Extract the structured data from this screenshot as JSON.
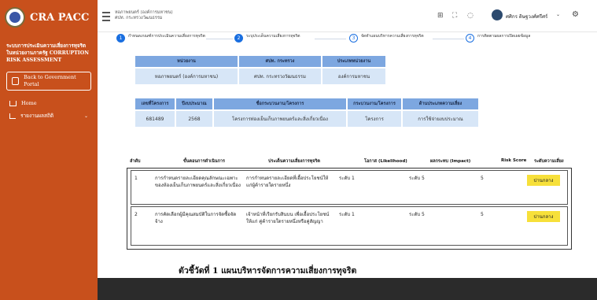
{
  "sidebar": {
    "brand": "CRA PACC",
    "description": "ระบบการประเมินความเสี่ยงการทุจริตในหน่วยงานภาครัฐ CORRUPTION RISK ASSESSMENT",
    "back_button": "Back to Government Portal",
    "nav": [
      {
        "label": "Home",
        "icon": "house-icon"
      },
      {
        "label": "รายงานผลสถิติ",
        "icon": "chart-icon"
      }
    ]
  },
  "topbar": {
    "agency": "หอภาพยนตร์ (องค์การมหาชน)",
    "ministry": "ศปท. กระทรวงวัฒนธรรม",
    "user_name": "ศศิกร ดิษฐวงศ์ศรีศร์"
  },
  "steps": [
    {
      "num": "1",
      "label": "กำหนดเกณฑ์การประเมินความเสี่ยงการทุจริต"
    },
    {
      "num": "2",
      "label": "ระบุประเด็นความเสี่ยงการทุจริต"
    },
    {
      "num": "3",
      "label": "จัดทำแผนบริหารความเสี่ยงการทุจริต"
    },
    {
      "num": "4",
      "label": "การติดตามผลการเปิดเผยข้อมูล"
    }
  ],
  "agency_table": {
    "headers": [
      "หน่วยงาน",
      "ศปท. กระทรวง",
      "ประเภทหน่วยงาน"
    ],
    "row": [
      "หอภาพยนตร์ (องค์การมหาชน)",
      "ศปท. กระทรวงวัฒนธรรม",
      "องค์การมหาชน"
    ]
  },
  "project_table": {
    "headers": [
      "เลขที่โครงการ",
      "ปีงบประมาณ",
      "ชื่อกระบวนงาน/โครงการ",
      "กระบวนงาน/โครงการ",
      "ด้านประเภทความเสี่ยง"
    ],
    "row": [
      "681489",
      "2568",
      "โครงการท่องเย็นเก็บภาพยนตร์และสิ่งเกี่ยวเนื่อง",
      "โครงการ",
      "การใช้จ่ายงบประมาณ"
    ]
  },
  "risk_table": {
    "headers": [
      "ลำดับ",
      "ขั้นตอนการดำเนินการ",
      "ประเด็นความเสี่ยงการทุจริต",
      "โอกาส (Likelihood)",
      "ผลกระทบ (Impact)",
      "Risk Score",
      "ระดับความเสี่ยง"
    ],
    "rows": [
      {
        "no": "1",
        "step": "การกำหนดรายละเอียดคุณลักษณะเฉพาะของห้องเย็นเก็บภาพยนตร์และสิ่งเกี่ยวเนื่อง",
        "risk": "การกำหนดรายละเอียดที่เอื้อประโยชน์ให้แก่ผู้ค้ารายใดรายหนึ่ง",
        "likelihood": "ระดับ 1",
        "impact": "ระดับ 5",
        "score": "5",
        "level": "ปานกลาง"
      },
      {
        "no": "2",
        "step": "การคัดเลือกผู้มีคุณสมบัติในการจัดซื้อจัดจ้าง",
        "risk": "เจ้าหน้าที่เรียกรับสินบน เพื่อเอื้อประโยชน์ให้แก่ คู่ค้ารายใดรายหนึ่งหรือคู่สัญญา",
        "likelihood": "ระดับ 1",
        "impact": "ระดับ 5",
        "score": "5",
        "level": "ปานกลาง"
      }
    ]
  },
  "indicator_title": "ตัวชี้วัดที่ 1 แผนบริหารจัดการความเสี่ยงการทุจริต",
  "colors": {
    "sidebar": "#c8501c",
    "header_blue": "#7da7e0",
    "cell_blue": "#d7e6f7",
    "badge": "#f7e03a",
    "step_active": "#1a6fe0"
  }
}
